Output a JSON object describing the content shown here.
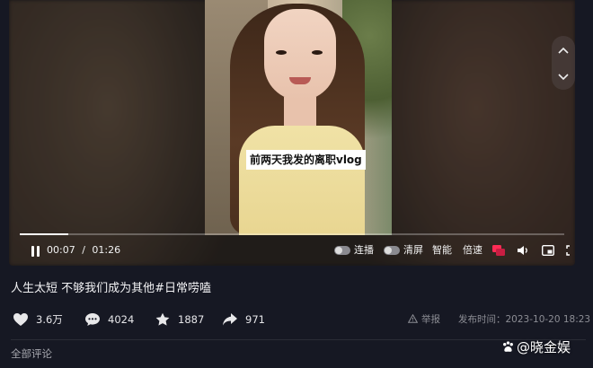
{
  "video": {
    "caption": "前两天我发的离职vlog",
    "progress_fraction": 0.089
  },
  "controls": {
    "current_time": "00:07",
    "separator": "/",
    "duration": "01:26",
    "autoplay_label": "连播",
    "clear_screen_label": "清屏",
    "smart_label": "智能",
    "speed_label": "倍速"
  },
  "post": {
    "title": "人生太短  不够我们成为其他#日常唠嗑"
  },
  "stats": {
    "likes": "3.6万",
    "comments": "4024",
    "favorites": "1887",
    "shares": "971"
  },
  "meta": {
    "report_label": "举报",
    "publish_label": "发布时间：2023-10-20  18:23"
  },
  "comments": {
    "tab_label": "全部评论"
  },
  "watermark": {
    "text": "@晓金娱"
  },
  "colors": {
    "page_bg": "#161823",
    "accent_red": "#fe2c55",
    "caption_bg": "#ffffff"
  }
}
